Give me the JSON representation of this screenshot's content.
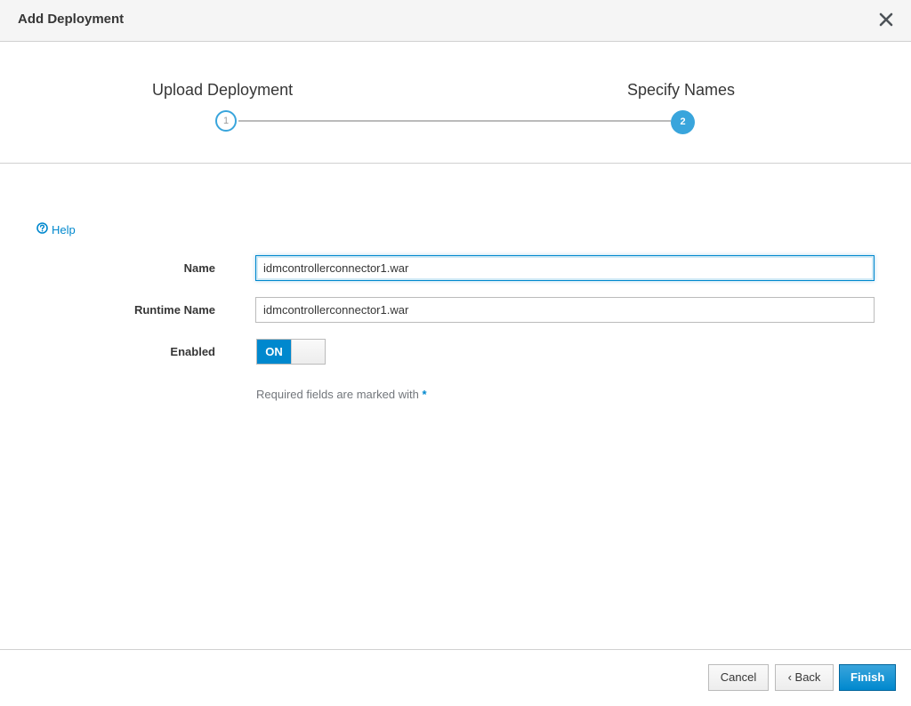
{
  "dialog": {
    "title": "Add Deployment",
    "close_icon": "close-icon"
  },
  "wizard": {
    "steps": [
      {
        "number": "1",
        "label": "Upload Deployment",
        "state": "completed"
      },
      {
        "number": "2",
        "label": "Specify Names",
        "state": "active"
      }
    ]
  },
  "form": {
    "help_label": "Help",
    "help_icon": "question-circle-icon",
    "name_label": "Name",
    "name_value": "idmcontrollerconnector1.war",
    "runtime_name_label": "Runtime Name",
    "runtime_name_value": "idmcontrollerconnector1.war",
    "enabled_label": "Enabled",
    "enabled_state": "ON",
    "required_note": "Required fields are marked with",
    "required_marker": "*"
  },
  "footer": {
    "cancel_label": "Cancel",
    "back_label": "‹ Back",
    "finish_label": "Finish"
  },
  "colors": {
    "accent": "#0088ce",
    "step_active": "#39a5dc",
    "header_bg": "#f5f5f5"
  }
}
